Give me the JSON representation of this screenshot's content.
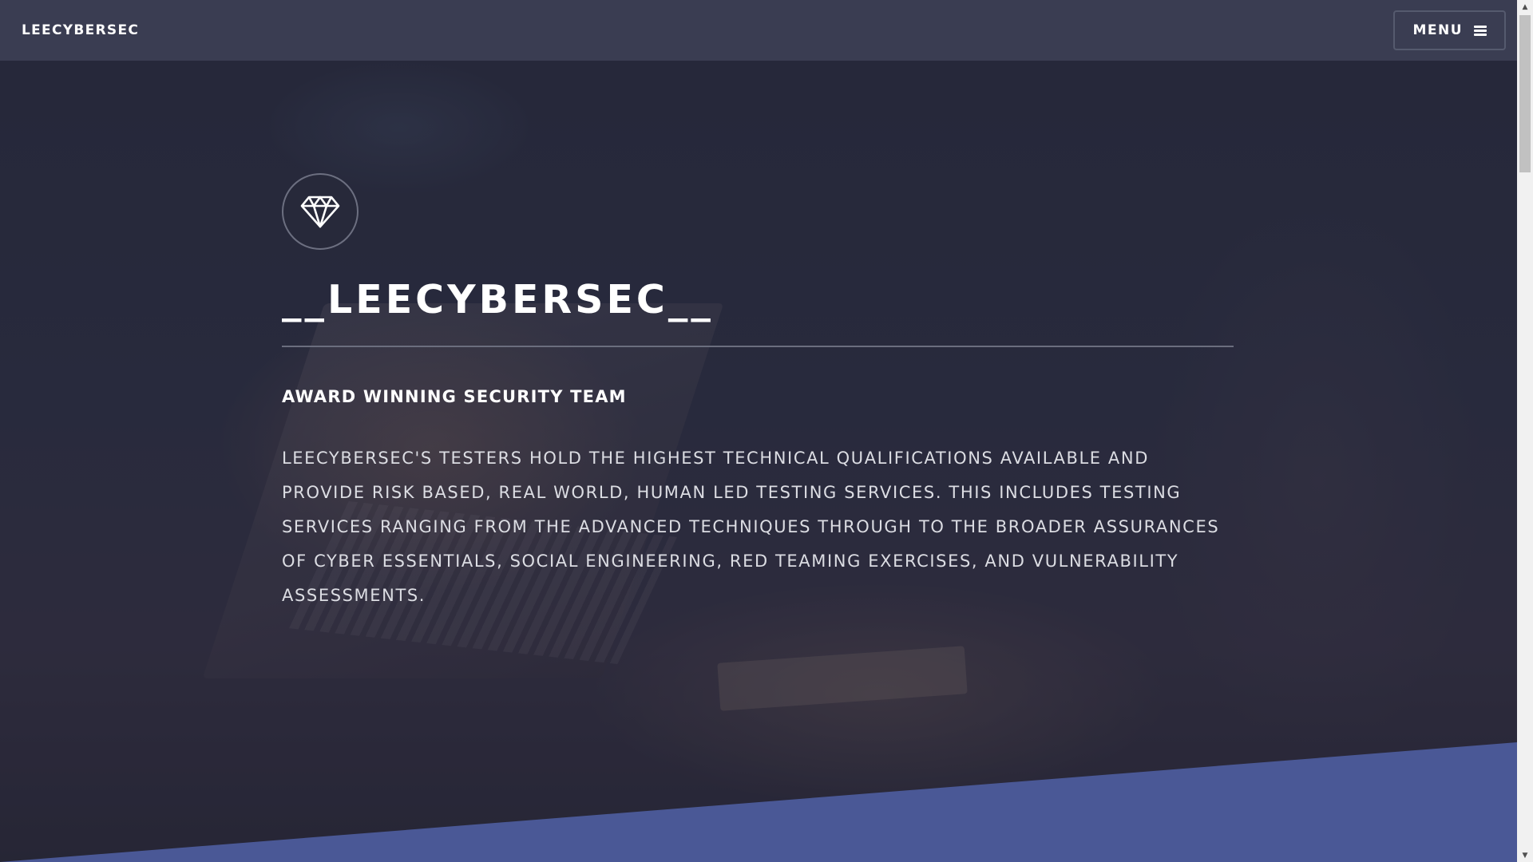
{
  "navbar": {
    "brand": "LEECYBERSEC",
    "menu_label": "MENU",
    "menu_icon": "hamburger-icon"
  },
  "hero": {
    "logo_icon": "diamond-icon",
    "title": "__LEECYBERSEC__",
    "subtitle": "AWARD WINNING SECURITY TEAM",
    "description": "LEECYBERSEC'S TESTERS HOLD THE HIGHEST TECHNICAL QUALIFICATIONS AVAILABLE AND PROVIDE RISK BASED, REAL WORLD, HUMAN LED TESTING SERVICES. THIS INCLUDES TESTING SERVICES RANGING FROM THE ADVANCED TECHNIQUES THROUGH TO THE BROADER ASSURANCES OF CYBER ESSENTIALS, SOCIAL ENGINEERING, RED TEAMING EXERCISES, AND VULNERABILITY ASSESSMENTS."
  },
  "colors": {
    "navbar_bg": "#3a3d52",
    "band": "#4a5896",
    "text": "#ffffff"
  },
  "scrollbar": {
    "up_icon": "scroll-up-arrow-icon",
    "down_icon": "scroll-down-arrow-icon"
  }
}
